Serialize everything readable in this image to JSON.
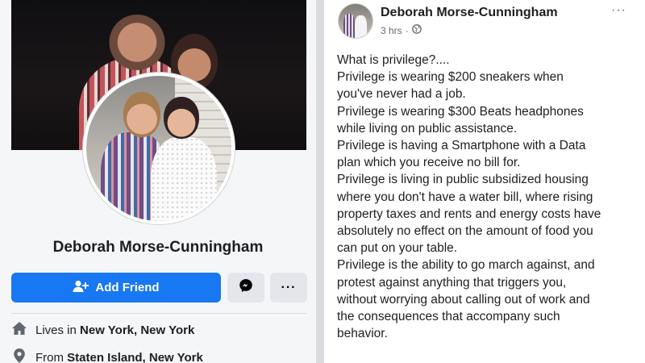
{
  "profile": {
    "name": "Deborah Morse-Cunningham",
    "add_friend_label": "Add Friend",
    "more_label": "···",
    "lives_in_prefix": "Lives in",
    "lives_in_value": "New York, New York",
    "from_prefix": "From",
    "from_value": "Staten Island, New York"
  },
  "post": {
    "author": "Deborah Morse-Cunningham",
    "time": "3 hrs",
    "separator": "·",
    "more_label": "···",
    "lines": [
      "What is privilege?....",
      "Privilege is wearing $200 sneakers when",
      "you've never had a job.",
      "Privilege is wearing $300 Beats headphones",
      "while living on public assistance.",
      "Privilege is having a Smartphone with a Data",
      "plan which you receive no bill for.",
      "Privilege is living in public subsidized housing",
      "where you don't have a water bill, where rising",
      "property taxes and rents and energy costs have",
      "absolutely no effect on the amount of food you",
      "can put on your table.",
      "Privilege is the ability to go march against, and",
      "protest against anything that triggers you,",
      "without worrying about calling out of work and",
      "the consequences that accompany such",
      "behavior."
    ]
  },
  "colors": {
    "accent": "#1877f2",
    "text": "#1c1e21",
    "muted": "#65676b"
  },
  "icons": [
    "add-friend-icon",
    "messenger-icon",
    "more-icon",
    "home-icon",
    "location-pin-icon",
    "globe-icon"
  ]
}
